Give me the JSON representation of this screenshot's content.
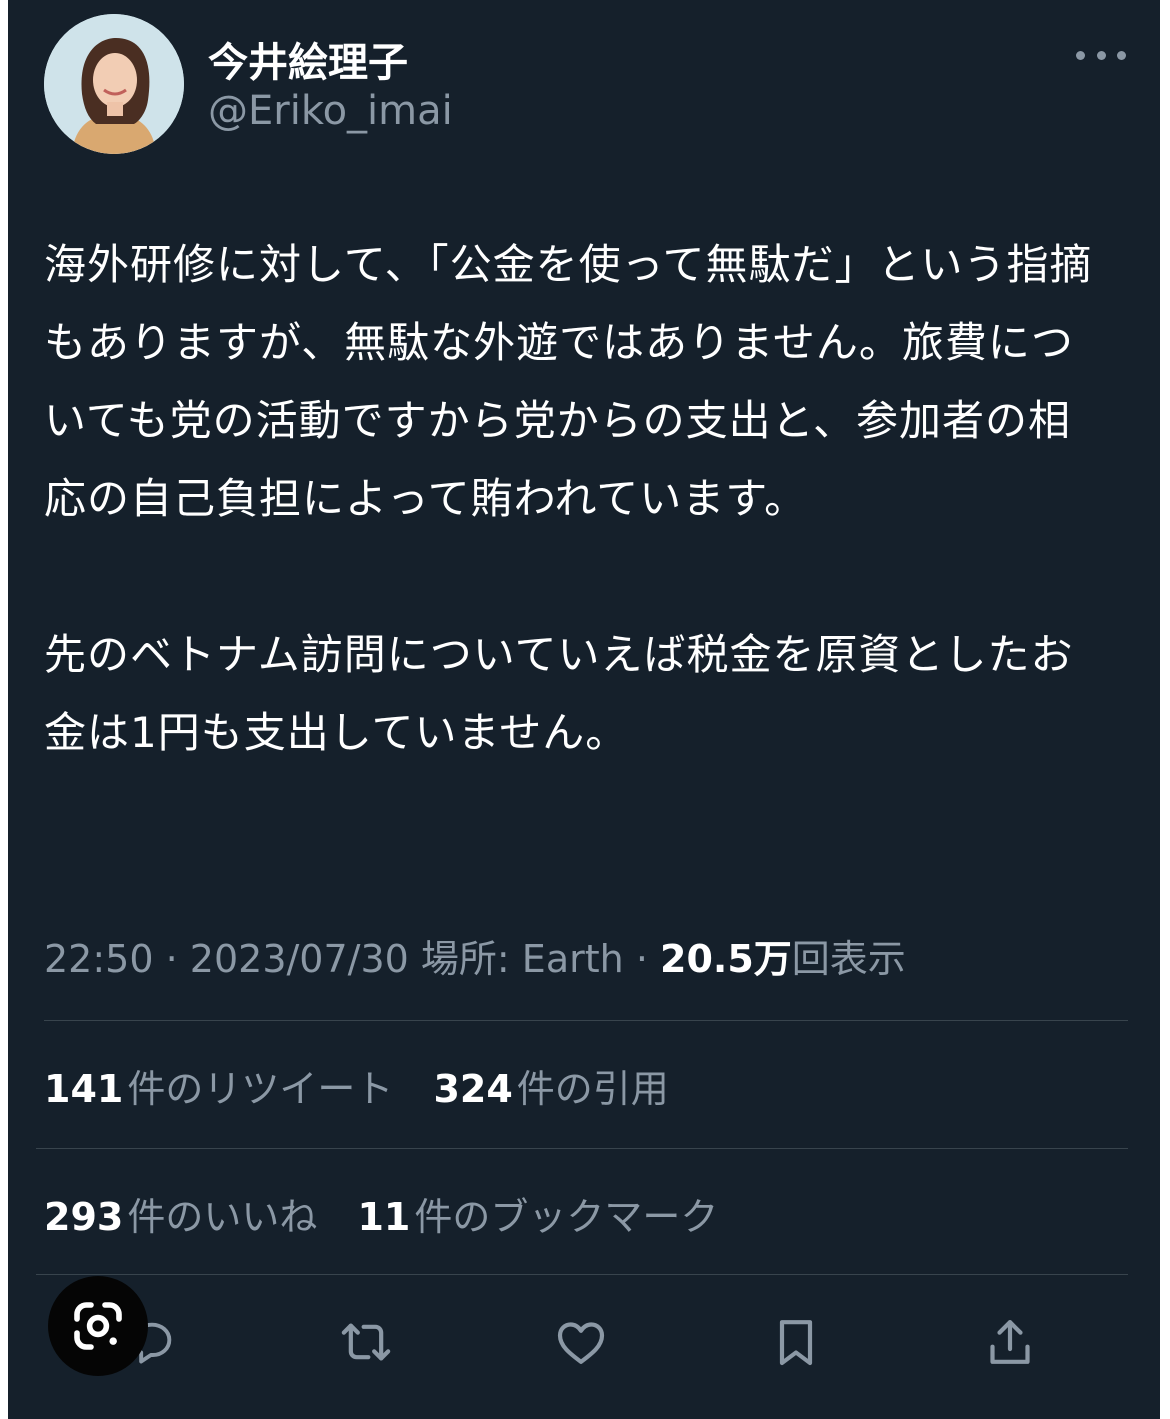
{
  "author": {
    "display_name": "今井絵理子",
    "handle": "@Eriko_imai",
    "avatar_icon": "profile-photo-icon"
  },
  "tweet": {
    "paragraphs": [
      "海外研修に対して、「公金を使って無駄だ」という指摘もありますが、無駄な外遊ではありません。旅費についても党の活動ですから党からの支出と、参加者の相応の自己負担によって賄われています。",
      "先のベトナム訪問についていえば税金を原資としたお金は1円も支出していません。"
    ]
  },
  "meta": {
    "time": "22:50",
    "date": "2023/07/30",
    "location": "場所: Earth",
    "views_count": "20.5万",
    "views_label": "回表示",
    "separator": "·"
  },
  "stats": {
    "retweets": {
      "count": "141",
      "label": "件のリツイート"
    },
    "quotes": {
      "count": "324",
      "label": "件の引用"
    },
    "likes": {
      "count": "293",
      "label": "件のいいね"
    },
    "bookmarks": {
      "count": "11",
      "label": "件のブックマーク"
    }
  },
  "actions": {
    "icons": [
      "reply-icon",
      "retweet-icon",
      "like-icon",
      "bookmark-icon",
      "share-icon"
    ]
  },
  "overlay": {
    "icon": "google-lens-icon"
  },
  "colors": {
    "background": "#15202b",
    "text_primary": "#ffffff",
    "text_secondary": "#8b98a5",
    "divider": "#38444d"
  }
}
